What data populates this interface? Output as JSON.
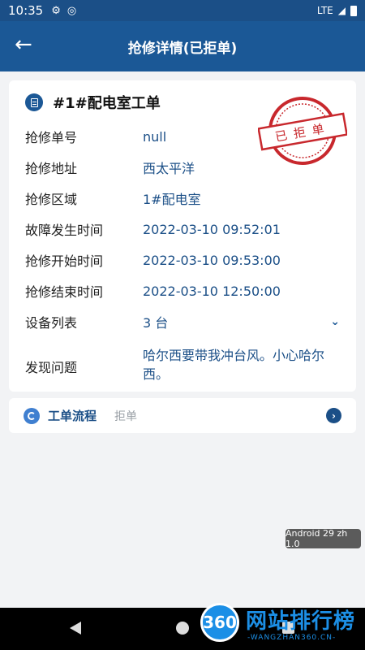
{
  "status_bar": {
    "time": "10:35",
    "network": "LTE"
  },
  "app_bar": {
    "title": "抢修详情(已拒单)"
  },
  "work_order": {
    "title": "#1#配电室工单",
    "stamp_text": "已拒单",
    "fields": [
      {
        "label": "抢修单号",
        "value": "null"
      },
      {
        "label": "抢修地址",
        "value": "西太平洋"
      },
      {
        "label": "抢修区域",
        "value": "1#配电室"
      },
      {
        "label": "故障发生时间",
        "value": "2022-03-10 09:52:01"
      },
      {
        "label": "抢修开始时间",
        "value": "2022-03-10 09:53:00"
      },
      {
        "label": "抢修结束时间",
        "value": "2022-03-10 12:50:00"
      }
    ],
    "device_list": {
      "label": "设备列表",
      "value": "3 台"
    },
    "problem": {
      "label": "发现问题",
      "value": "哈尔西要带我冲台风。小心哈尔西。"
    }
  },
  "flow": {
    "title": "工单流程",
    "status": "拒单"
  },
  "toast": {
    "text": "Android 29 zh 1.0"
  },
  "watermark": {
    "logo": "360",
    "text": "网站排行榜",
    "sub": "-WANGZHAN360.CN-"
  },
  "colors": {
    "primary": "#1b5896",
    "status_bar": "#1b4f87",
    "value_text": "#1b4f87",
    "stamp_red": "#c8282d"
  }
}
